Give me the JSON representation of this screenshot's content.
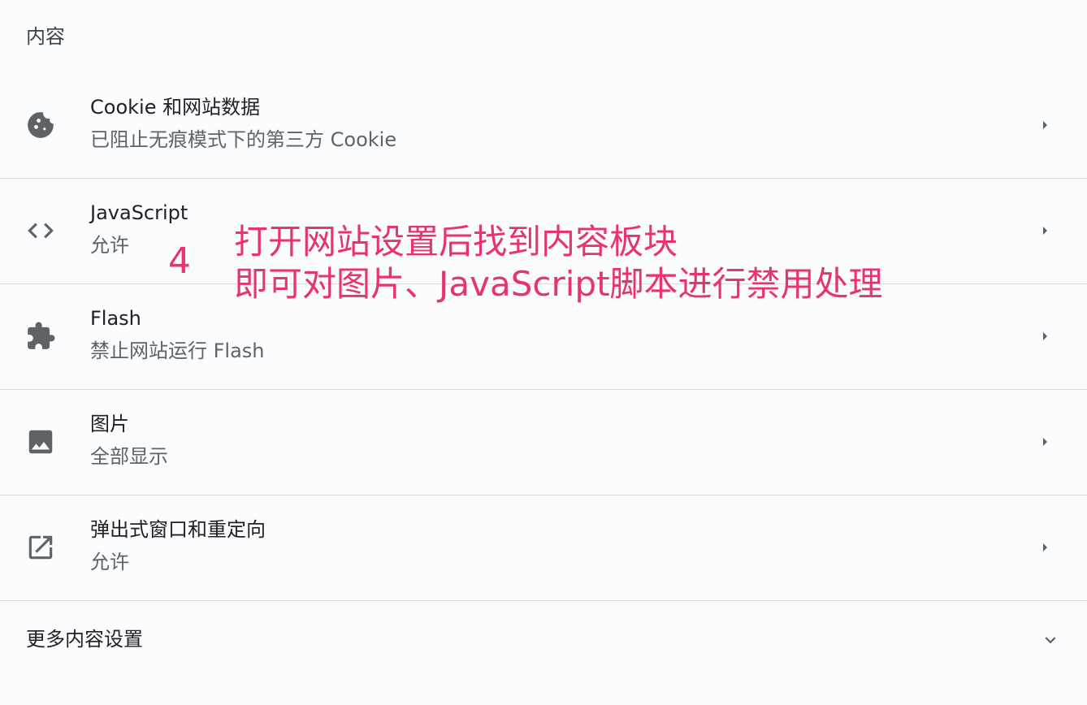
{
  "section": {
    "title": "内容"
  },
  "rows": [
    {
      "icon": "cookie-icon",
      "title": "Cookie 和网站数据",
      "subtitle": "已阻止无痕模式下的第三方 Cookie"
    },
    {
      "icon": "code-icon",
      "title": "JavaScript",
      "subtitle": "允许"
    },
    {
      "icon": "puzzle-icon",
      "title": "Flash",
      "subtitle": "禁止网站运行 Flash"
    },
    {
      "icon": "image-icon",
      "title": "图片",
      "subtitle": "全部显示"
    },
    {
      "icon": "open-in-new-icon",
      "title": "弹出式窗口和重定向",
      "subtitle": "允许"
    }
  ],
  "more": {
    "label": "更多内容设置",
    "icon": "chevron-down-icon"
  },
  "annotation": {
    "number": "4",
    "line1": "打开网站设置后找到内容板块",
    "line2": "即可对图片、JavaScript脚本进行禁用处理",
    "color": "#e8336e"
  },
  "colors": {
    "background": "#fbfcfe",
    "divider": "#dadce0",
    "icon": "#5f6368",
    "primary_text": "#202124",
    "secondary_text": "#5f6368"
  }
}
